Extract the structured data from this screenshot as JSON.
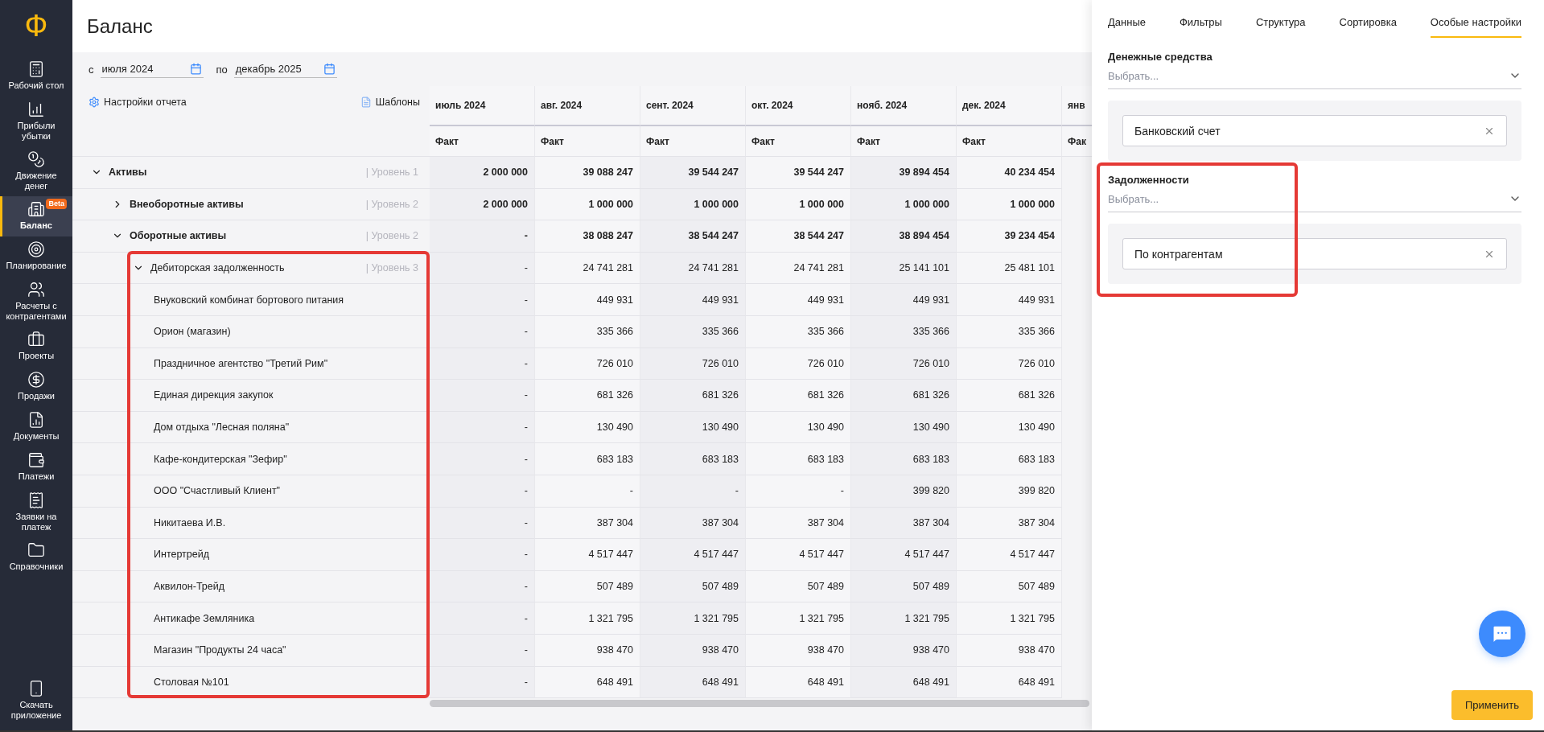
{
  "sidebar": {
    "logo": "Ф",
    "items": [
      {
        "label": "Рабочий стол",
        "selected": false
      },
      {
        "label": "Прибыли убытки",
        "selected": false
      },
      {
        "label": "Движение денег",
        "selected": false
      },
      {
        "label": "Баланс",
        "selected": true,
        "badge": "Beta"
      },
      {
        "label": "Планирование",
        "selected": false
      },
      {
        "label": "Расчеты с контрагентами",
        "selected": false
      },
      {
        "label": "Проекты",
        "selected": false
      },
      {
        "label": "Продажи",
        "selected": false
      },
      {
        "label": "Документы",
        "selected": false
      },
      {
        "label": "Платежи",
        "selected": false
      },
      {
        "label": "Заявки на платеж",
        "selected": false
      },
      {
        "label": "Справочники",
        "selected": false
      }
    ],
    "download": "Скачать приложение"
  },
  "page": {
    "title": "Баланс"
  },
  "period": {
    "from_label": "с",
    "from": "июля 2024",
    "to_label": "по",
    "to": "декабрь 2025"
  },
  "report": {
    "settings": "Настройки отчета",
    "templates": "Шаблоны"
  },
  "table": {
    "columns": [
      {
        "month": "июль 2024",
        "sub": "Факт"
      },
      {
        "month": "авг. 2024",
        "sub": "Факт"
      },
      {
        "month": "сент. 2024",
        "sub": "Факт"
      },
      {
        "month": "окт. 2024",
        "sub": "Факт"
      },
      {
        "month": "нояб. 2024",
        "sub": "Факт"
      },
      {
        "month": "дек. 2024",
        "sub": "Факт"
      },
      {
        "month": "янв",
        "sub": "Фак"
      }
    ],
    "rows": [
      {
        "label": "Активы",
        "level": "| Уровень 1",
        "expanded": true,
        "values": [
          "2 000 000",
          "39 088 247",
          "39 544 247",
          "39 544 247",
          "39 894 454",
          "40 234 454"
        ],
        "children": [
          {
            "label": "Внеоборотные активы",
            "level": "| Уровень 2",
            "expanded": false,
            "values": [
              "2 000 000",
              "1 000 000",
              "1 000 000",
              "1 000 000",
              "1 000 000",
              "1 000 000"
            ]
          },
          {
            "label": "Оборотные активы",
            "level": "| Уровень 2",
            "expanded": true,
            "values": [
              "-",
              "38 088 247",
              "38 544 247",
              "38 544 247",
              "38 894 454",
              "39 234 454"
            ],
            "children": [
              {
                "label": "Дебиторская задолженность",
                "level": "| Уровень 3",
                "expanded": true,
                "highlighted": true,
                "values": [
                  "-",
                  "24 741 281",
                  "24 741 281",
                  "24 741 281",
                  "25 141 101",
                  "25 481 101"
                ],
                "children": [
                  {
                    "label": "Внуковский комбинат бортового питания",
                    "values": [
                      "-",
                      "449 931",
                      "449 931",
                      "449 931",
                      "449 931",
                      "449 931"
                    ]
                  },
                  {
                    "label": "Орион (магазин)",
                    "values": [
                      "-",
                      "335 366",
                      "335 366",
                      "335 366",
                      "335 366",
                      "335 366"
                    ]
                  },
                  {
                    "label": "Праздничное агентство \"Третий Рим\"",
                    "values": [
                      "-",
                      "726 010",
                      "726 010",
                      "726 010",
                      "726 010",
                      "726 010"
                    ]
                  },
                  {
                    "label": "Единая дирекция закупок",
                    "values": [
                      "-",
                      "681 326",
                      "681 326",
                      "681 326",
                      "681 326",
                      "681 326"
                    ]
                  },
                  {
                    "label": "Дом отдыха \"Лесная поляна\"",
                    "values": [
                      "-",
                      "130 490",
                      "130 490",
                      "130 490",
                      "130 490",
                      "130 490"
                    ]
                  },
                  {
                    "label": "Кафе-кондитерская \"Зефир\"",
                    "values": [
                      "-",
                      "683 183",
                      "683 183",
                      "683 183",
                      "683 183",
                      "683 183"
                    ]
                  },
                  {
                    "label": "ООО \"Счастливый Клиент\"",
                    "values": [
                      "-",
                      "-",
                      "-",
                      "-",
                      "399 820",
                      "399 820"
                    ]
                  },
                  {
                    "label": "Никитаева И.В.",
                    "values": [
                      "-",
                      "387 304",
                      "387 304",
                      "387 304",
                      "387 304",
                      "387 304"
                    ]
                  },
                  {
                    "label": "Интертрейд",
                    "values": [
                      "-",
                      "4 517 447",
                      "4 517 447",
                      "4 517 447",
                      "4 517 447",
                      "4 517 447"
                    ]
                  },
                  {
                    "label": "Аквилон-Трейд",
                    "values": [
                      "-",
                      "507 489",
                      "507 489",
                      "507 489",
                      "507 489",
                      "507 489"
                    ]
                  },
                  {
                    "label": "Антикафе Земляника",
                    "values": [
                      "-",
                      "1 321 795",
                      "1 321 795",
                      "1 321 795",
                      "1 321 795",
                      "1 321 795"
                    ]
                  },
                  {
                    "label": "Магазин \"Продукты 24 часа\"",
                    "values": [
                      "-",
                      "938 470",
                      "938 470",
                      "938 470",
                      "938 470",
                      "938 470"
                    ]
                  },
                  {
                    "label": "Столовая №101",
                    "values": [
                      "-",
                      "648 491",
                      "648 491",
                      "648 491",
                      "648 491",
                      "648 491"
                    ]
                  }
                ]
              }
            ]
          }
        ]
      }
    ]
  },
  "panel": {
    "tabs": [
      {
        "label": "Данные",
        "selected": false
      },
      {
        "label": "Фильтры",
        "selected": false
      },
      {
        "label": "Структура",
        "selected": false
      },
      {
        "label": "Сортировка",
        "selected": false
      },
      {
        "label": "Особые настройки",
        "selected": true
      }
    ],
    "sections": [
      {
        "title": "Денежные средства",
        "placeholder": "Выбрать...",
        "chip": "Банковский счет",
        "highlighted": false
      },
      {
        "title": "Задолженности",
        "placeholder": "Выбрать...",
        "chip": "По контрагентам",
        "highlighted": true
      }
    ],
    "apply": "Применить"
  }
}
